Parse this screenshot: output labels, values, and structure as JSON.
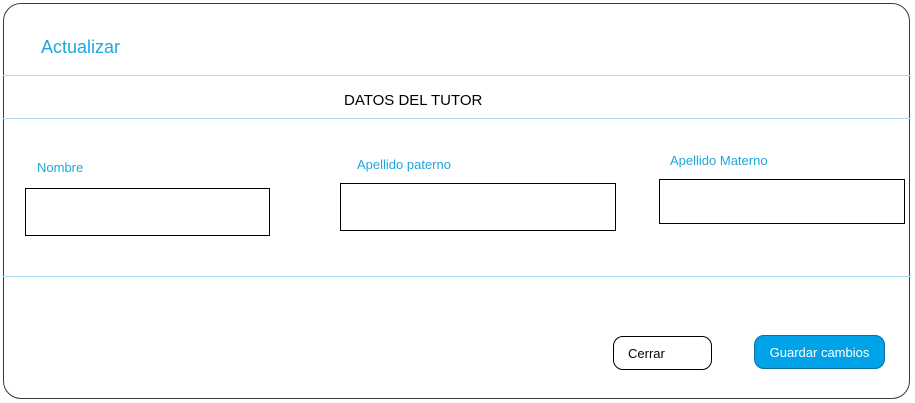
{
  "modal": {
    "title": "Actualizar"
  },
  "section": {
    "title": "DATOS DEL TUTOR"
  },
  "fields": [
    {
      "label": "Nombre",
      "value": ""
    },
    {
      "label": "Apellido paterno",
      "value": ""
    },
    {
      "label": "Apellido Materno",
      "value": ""
    }
  ],
  "buttons": {
    "close_label": "Cerrar",
    "save_label": "Guardar cambios"
  },
  "colors": {
    "accent": "#1fa7dd",
    "primary_button": "#00a2e8",
    "divider": "#a9dcef"
  }
}
